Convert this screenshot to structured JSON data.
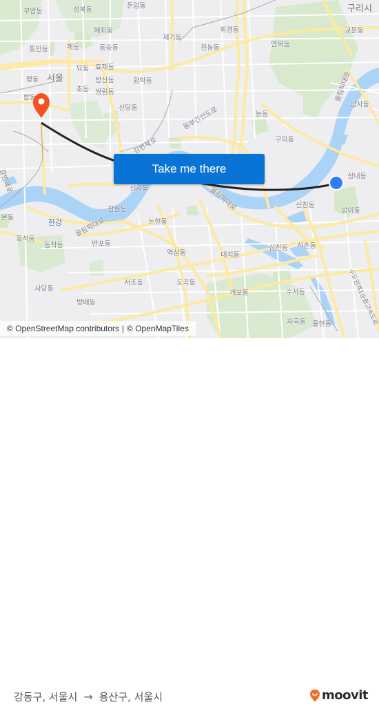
{
  "map": {
    "labels": {
      "buam": "부암동",
      "seongbuk": "성북동",
      "donam": "돈암동",
      "hyehwa": "혜화동",
      "jegi": "제기동",
      "hwigyeong": "휘경동",
      "guri": "구리시",
      "gyomun": "교문동",
      "tongin": "통인동",
      "gye": "계동",
      "dongsung": "동숭동",
      "jeonnong": "전농동",
      "myeonmok": "면목동",
      "pyeong": "평동",
      "seoul": "서울",
      "myo": "묘동",
      "hyoje": "효제동",
      "bangsan": "방산동",
      "hwanghak": "황학동",
      "cho": "초동",
      "ssangrim": "쌍림동",
      "hap": "합동",
      "sindang": "신당동",
      "amsa": "암사동",
      "neung": "능동",
      "guui": "구의동",
      "seongnae": "성내동",
      "sinsa": "신사동",
      "jamwon": "잠원동",
      "sincheon": "신천동",
      "bangi": "방이동",
      "bon": "본동",
      "hangang": "한강",
      "heukseok": "흑석동",
      "dongjak": "동작동",
      "banpo": "반포동",
      "nonhyeon": "논현동",
      "yeoksam": "역삼동",
      "daechi": "대치동",
      "samjeon": "삼전동",
      "seokchon": "석촌동",
      "sadang": "사당동",
      "seocho": "서초동",
      "dogok": "도곡동",
      "gaepo": "개포동",
      "suseo": "수서동",
      "bangbae": "방배동",
      "jagok": "자곡동",
      "yulhyeon": "율현동",
      "road_gangbyeonbuk": "강변북로",
      "road_dongbu": "동부간선도로",
      "road_olympic": "올림픽대로",
      "road_olympic_left": "올림픽대로",
      "road_gangbyeon_left": "강변북로",
      "road_amsa": "올림픽대로",
      "road_capital": "수도권제1순환고속도로"
    },
    "origin_marker": {
      "type": "destination-pin",
      "color": "#f4511e"
    },
    "destination_marker": {
      "type": "current-location-dot",
      "color": "#2f7df6"
    },
    "route_color": "#222222"
  },
  "cta": {
    "label": "Take me there",
    "color": "#0a74d6"
  },
  "attribution": {
    "osm": "© OpenStreetMap contributors",
    "separator": "|",
    "omt": "© OpenMapTiles"
  },
  "footer": {
    "from": "강동구, 서울시",
    "arrow": "→",
    "to": "용산구, 서울시",
    "brand": "moovit",
    "brand_color": "#f26f21"
  }
}
